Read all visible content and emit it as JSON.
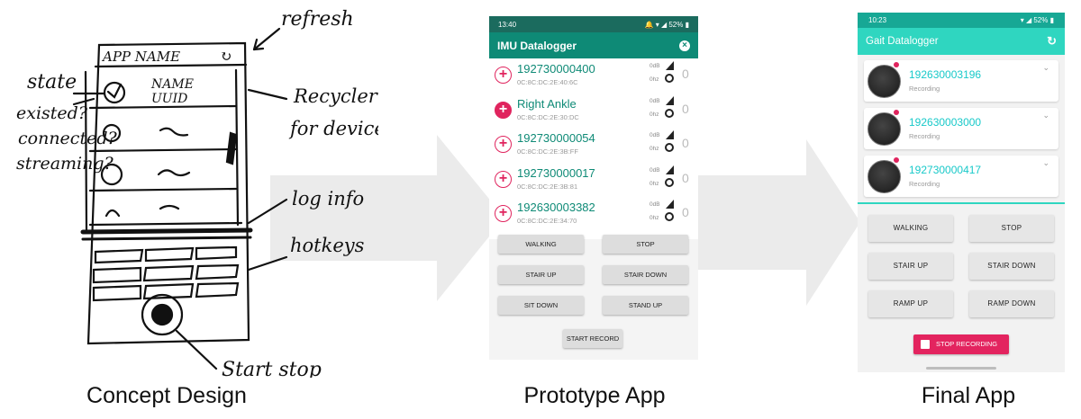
{
  "captions": {
    "concept": "Concept Design",
    "prototype": "Prototype App",
    "final": "Final App"
  },
  "sketch": {
    "app_name": "APP NAME",
    "refresh_note": "refresh",
    "state_note": "state",
    "state_options": [
      "existed?",
      "connected?",
      "streaming?"
    ],
    "device_label": "NAME",
    "device_sub": "UUID",
    "recycler_note": "Recycler view",
    "recycler_note_2": "for devices",
    "log_note": "log info",
    "hotkeys_note": "hotkeys",
    "startstop_note": "Start stop"
  },
  "prototype": {
    "time": "13:40",
    "battery": "52%",
    "title": "IMU Datalogger",
    "devices": [
      {
        "name": "192730000400",
        "mac": "0C:8C:DC:2E:40:6C",
        "db": "0dB",
        "hz": "0hz",
        "count": "0",
        "connected": false
      },
      {
        "name": "Right Ankle",
        "mac": "0C:8C:DC:2E:30:DC",
        "db": "0dB",
        "hz": "0hz",
        "count": "0",
        "connected": true
      },
      {
        "name": "192730000054",
        "mac": "0C:8C:DC:2E:3B:FF",
        "db": "0dB",
        "hz": "0hz",
        "count": "0",
        "connected": false
      },
      {
        "name": "192730000017",
        "mac": "0C:8C:DC:2E:3B:81",
        "db": "0dB",
        "hz": "0hz",
        "count": "0",
        "connected": false
      },
      {
        "name": "192630003382",
        "mac": "0C:8C:DC:2E:34:70",
        "db": "0dB",
        "hz": "0hz",
        "count": "0",
        "connected": false
      }
    ],
    "buttons": {
      "walking": "WALKING",
      "stop": "STOP",
      "stair_up": "STAIR UP",
      "stair_down": "STAIR DOWN",
      "sit_down": "SIT DOWN",
      "stand_up": "STAND UP",
      "start_record": "START RECORD"
    }
  },
  "final": {
    "time": "10:23",
    "battery": "52%",
    "title": "Gait Datalogger",
    "devices": [
      {
        "name": "192630003196",
        "status": "Recording"
      },
      {
        "name": "192630003000",
        "status": "Recording"
      },
      {
        "name": "192730000417",
        "status": "Recording"
      }
    ],
    "buttons": {
      "walking": "WALKING",
      "stop": "STOP",
      "stair_up": "STAIR UP",
      "stair_down": "STAIR DOWN",
      "ramp_up": "RAMP UP",
      "ramp_down": "RAMP DOWN",
      "stop_recording": "STOP RECORDING"
    }
  },
  "colors": {
    "proto_statusbar": "#1b6b5e",
    "proto_appbar": "#0e8a76",
    "final_statusbar": "#17a895",
    "final_appbar": "#2fd6c0",
    "accent_pink": "#e0245e",
    "final_device_text": "#18c9c9"
  }
}
